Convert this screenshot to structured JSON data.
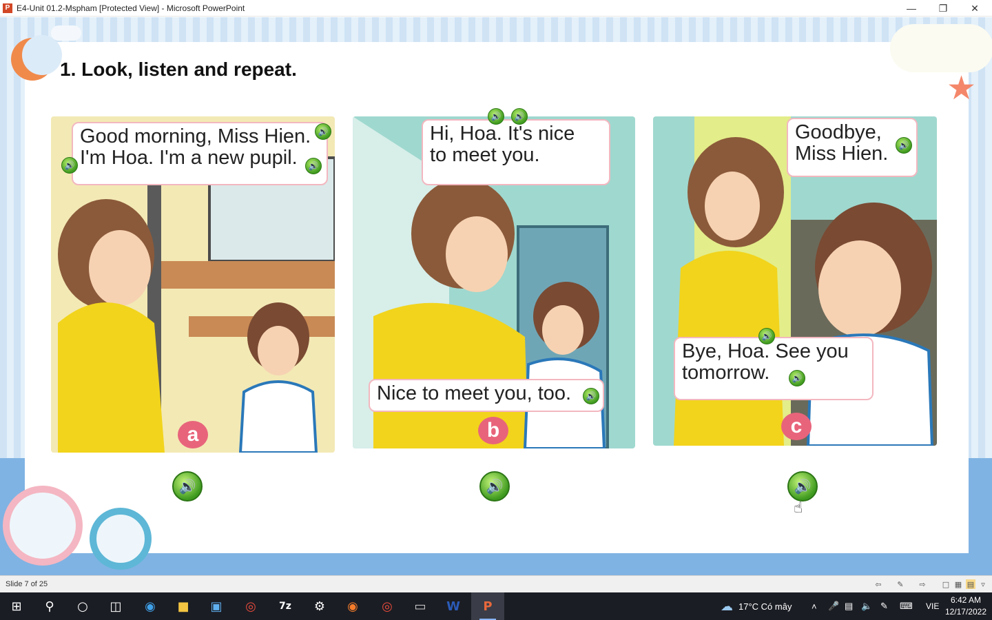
{
  "window": {
    "title": "E4-Unit 01.2-Mspham [Protected View] - Microsoft PowerPoint",
    "app_icon_letter": "P"
  },
  "slide": {
    "heading": "1. Look, listen and repeat.",
    "frames": [
      {
        "label": "a",
        "bubbles": [
          "Good morning, Miss Hien.\nI'm Hoa. I'm a new pupil."
        ]
      },
      {
        "label": "b",
        "bubbles": [
          "Hi, Hoa. It's nice\nto meet you.",
          "Nice to meet you, too."
        ]
      },
      {
        "label": "c",
        "bubbles": [
          "Goodbye,\nMiss Hien.",
          "Bye, Hoa. See you\ntomorrow."
        ]
      }
    ]
  },
  "statusbar": {
    "slide_indicator": "Slide 7 of 25"
  },
  "taskbar": {
    "weather": "17°C  Có mây",
    "language": "VIE",
    "time": "6:42 AM",
    "date": "12/17/2022"
  }
}
